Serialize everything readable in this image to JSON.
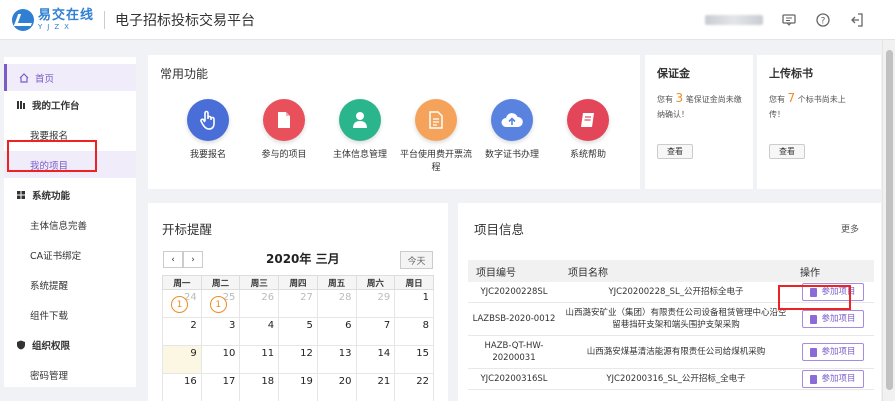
{
  "header": {
    "logo_cn": "易交在线",
    "logo_en": "YJZX",
    "platform_title": "电子招标投标交易平台"
  },
  "sidebar": {
    "home": "首页",
    "sections": [
      {
        "label": "我的工作台",
        "items": [
          "我要报名",
          "我的项目"
        ]
      },
      {
        "label": "系统功能",
        "items": [
          "主体信息完善",
          "CA证书绑定",
          "系统提醒",
          "组件下载"
        ]
      },
      {
        "label": "组织权限",
        "items": [
          "密码管理"
        ]
      }
    ]
  },
  "quick": {
    "title": "常用功能",
    "items": [
      {
        "label": "我要报名",
        "color": "#4a6ed8"
      },
      {
        "label": "参与的项目",
        "color": "#e8505b"
      },
      {
        "label": "主体信息管理",
        "color": "#2bb58c"
      },
      {
        "label": "平台使用费开票流程",
        "color": "#f5a35a"
      },
      {
        "label": "数字证书办理",
        "color": "#5a83e0"
      },
      {
        "label": "系统帮助",
        "color": "#e34659"
      }
    ]
  },
  "deposit": {
    "title": "保证金",
    "prefix": "您有",
    "count": "3",
    "suffix": "笔保证金尚未缴纳确认！",
    "button": "查看"
  },
  "upload": {
    "title": "上传标书",
    "prefix": "您有",
    "count": "7",
    "suffix": "个标书尚未上传！",
    "button": "查看"
  },
  "calendar": {
    "title": "开标提醒",
    "prev": "‹",
    "next": "›",
    "month": "2020年 三月",
    "today_button": "今天",
    "weekdays": [
      "周一",
      "周二",
      "周三",
      "周四",
      "周五",
      "周六",
      "周日"
    ],
    "weeks": [
      [
        {
          "d": "24",
          "o": true,
          "b": "1"
        },
        {
          "d": "25",
          "o": true,
          "b": "1"
        },
        {
          "d": "26",
          "o": true
        },
        {
          "d": "27",
          "o": true
        },
        {
          "d": "28",
          "o": true
        },
        {
          "d": "29",
          "o": true
        },
        {
          "d": "1"
        }
      ],
      [
        {
          "d": "2"
        },
        {
          "d": "3"
        },
        {
          "d": "4"
        },
        {
          "d": "5"
        },
        {
          "d": "6"
        },
        {
          "d": "7"
        },
        {
          "d": "8"
        }
      ],
      [
        {
          "d": "9",
          "t": true
        },
        {
          "d": "10"
        },
        {
          "d": "11"
        },
        {
          "d": "12"
        },
        {
          "d": "13"
        },
        {
          "d": "14"
        },
        {
          "d": "15"
        }
      ],
      [
        {
          "d": "16"
        },
        {
          "d": "17"
        },
        {
          "d": "18"
        },
        {
          "d": "19"
        },
        {
          "d": "20"
        },
        {
          "d": "21"
        },
        {
          "d": "22"
        }
      ]
    ]
  },
  "projects": {
    "title": "项目信息",
    "more": "更多",
    "columns": [
      "项目编号",
      "项目名称",
      "操作"
    ],
    "join_label": "参加项目",
    "rows": [
      {
        "code": "YJC20200228SL",
        "name": "YJC20200228_SL_公开招标全电子"
      },
      {
        "code": "LAZBSB-2020-0012",
        "name": "山西潞安矿业（集团）有限责任公司设备租赁管理中心沿空留巷挡矸支架和端头围护支架采购"
      },
      {
        "code": "HAZB-QT-HW-20200031",
        "name": "山西潞安煤基清洁能源有限责任公司给煤机采购"
      },
      {
        "code": "YJC20200316SL",
        "name": "YJC20200316_SL_公开招标_全电子"
      }
    ]
  }
}
